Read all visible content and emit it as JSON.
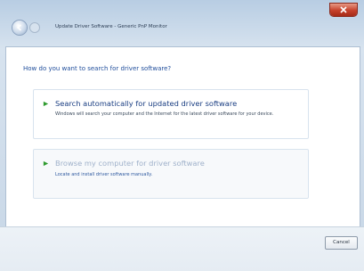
{
  "window": {
    "title": "Update Driver Software - Generic PnP Monitor"
  },
  "dialog": {
    "question": "How do you want to search for driver software?",
    "options": [
      {
        "title": "Search automatically for updated driver software",
        "description": "Windows will search your computer and the Internet for the latest driver software for your device."
      },
      {
        "title": "Browse my computer for driver software",
        "description": "Locate and install driver software manually."
      }
    ],
    "cancel_label": "Cancel"
  },
  "icons": {
    "back": "back-arrow-icon",
    "forward": "forward-arrow-icon",
    "close": "close-icon",
    "option_arrow": "green-arrow-icon"
  },
  "colors": {
    "accent_blue": "#1f4d9b",
    "option_arrow_green": "#2f9b2f",
    "close_red": "#c6422c"
  }
}
